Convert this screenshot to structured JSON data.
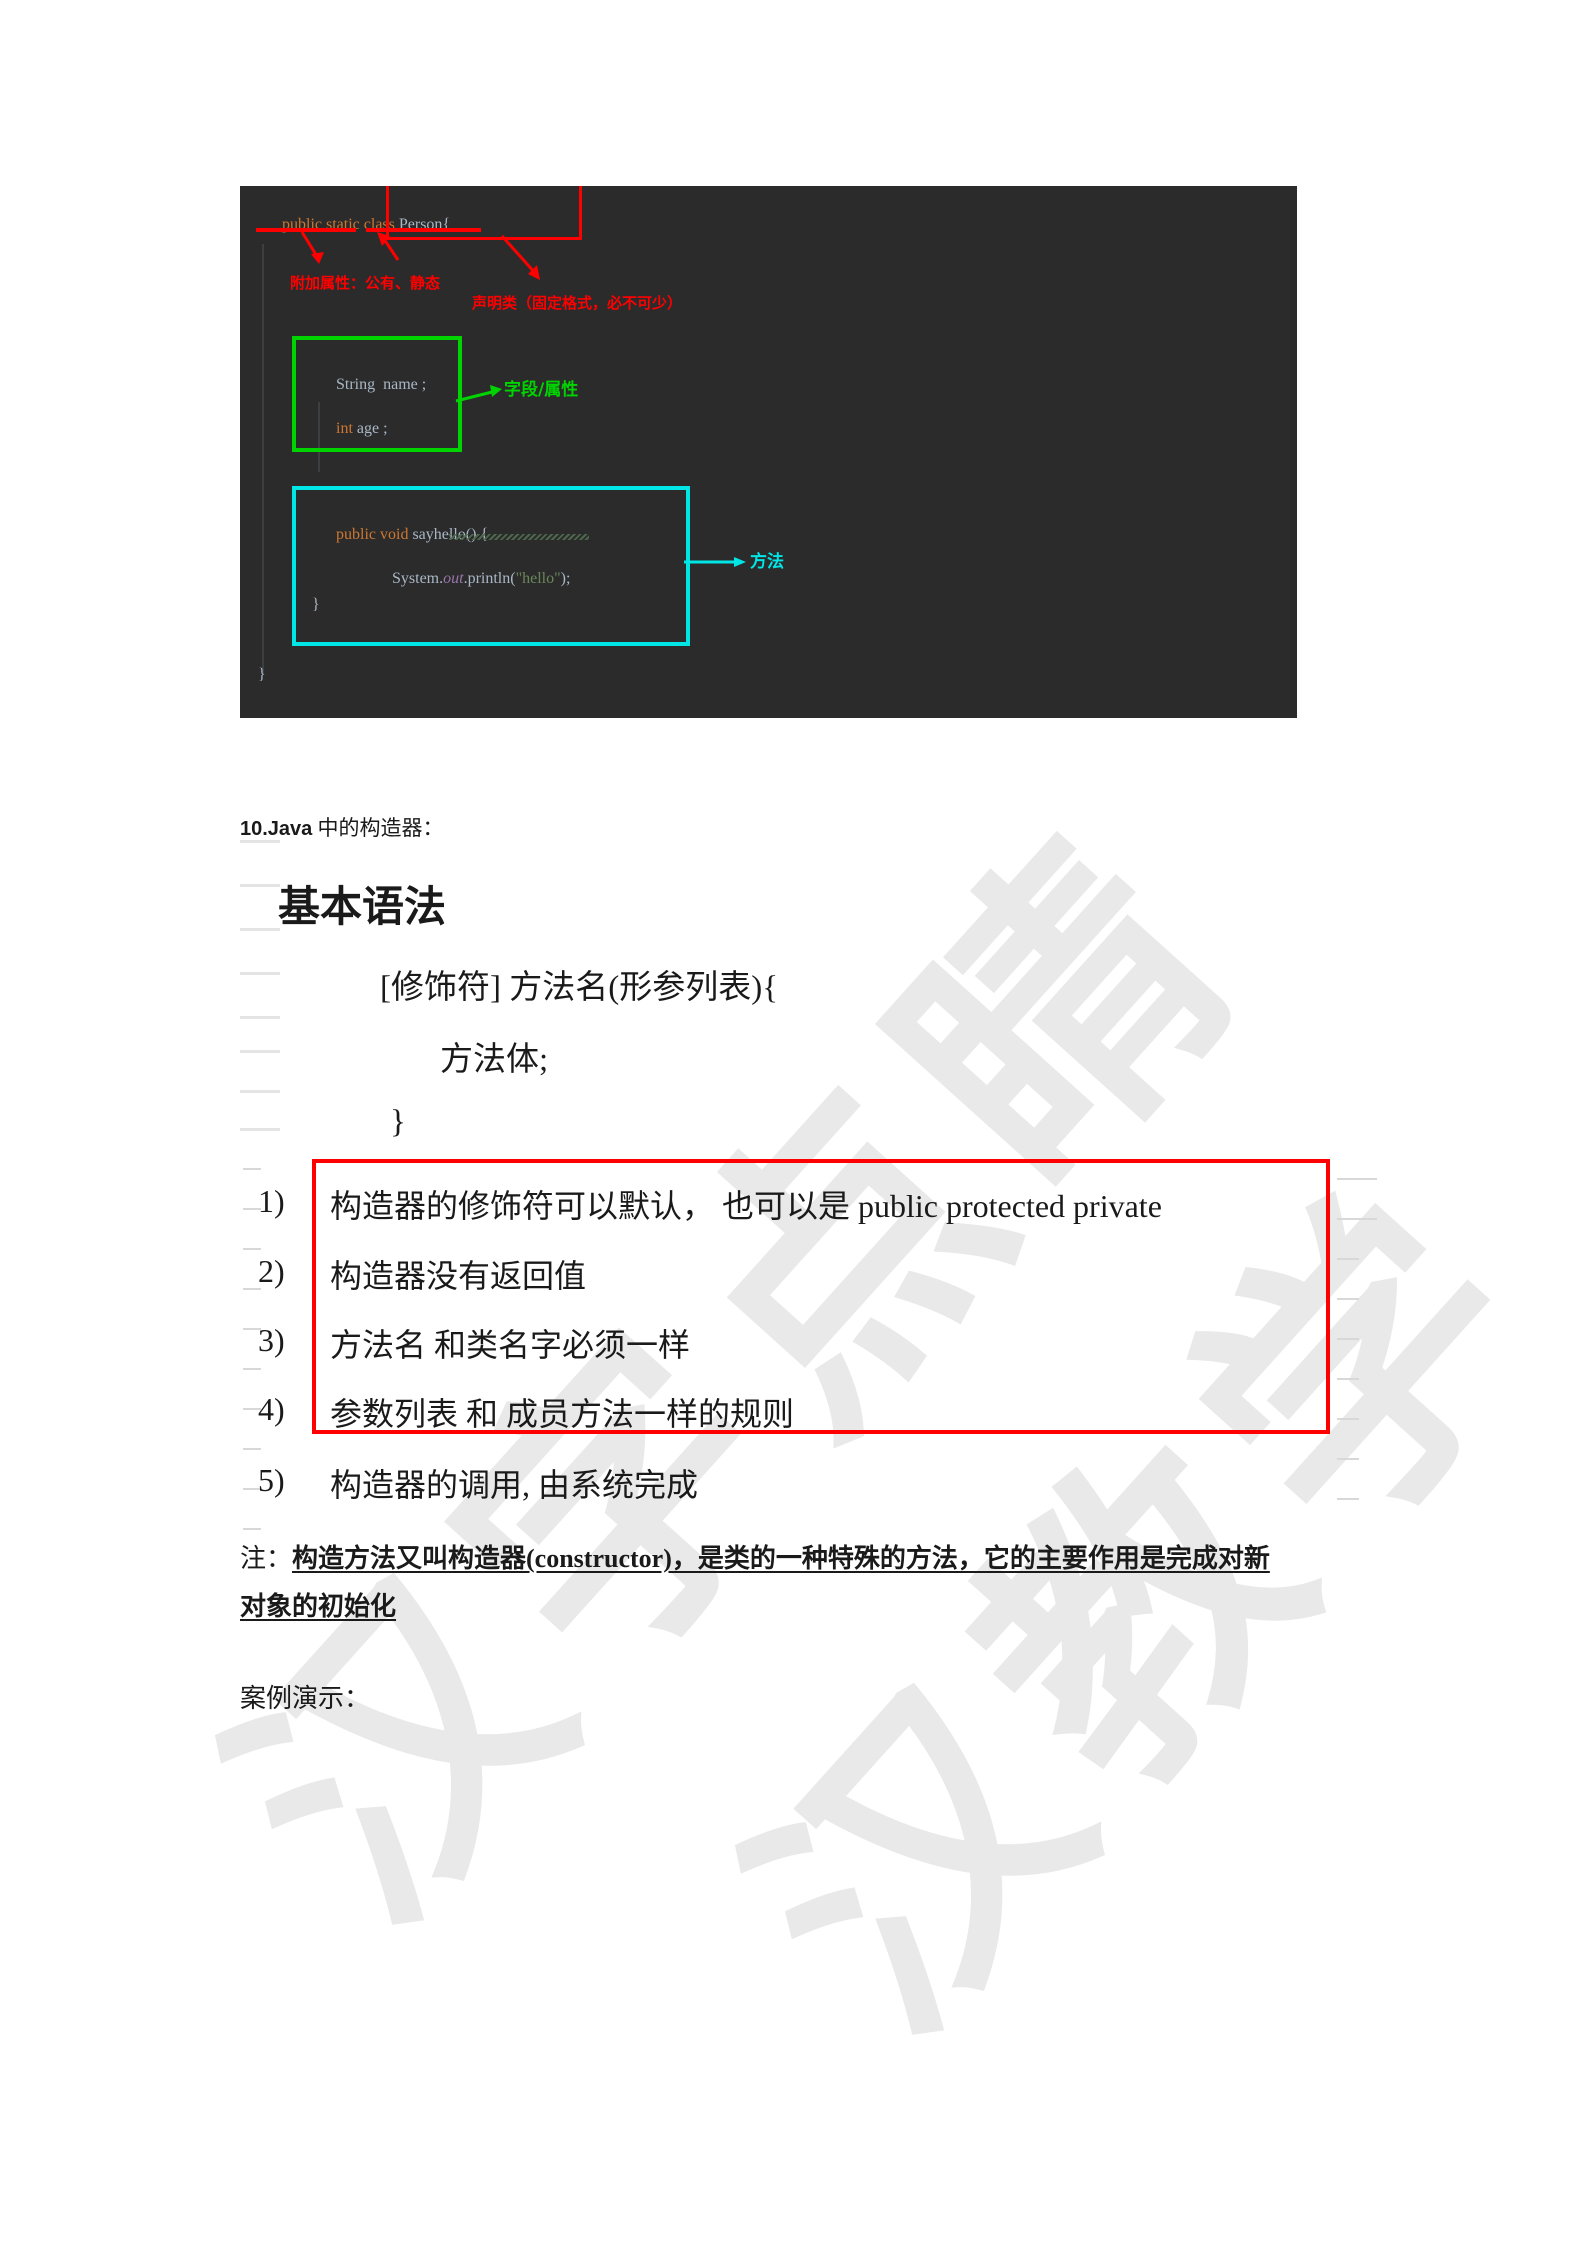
{
  "document": {
    "page_background": "#ffffff",
    "watermark": {
      "text_line1": "汉字点睛",
      "text_line2": "汉教学",
      "color": "#e9e9e9"
    }
  },
  "code_screenshot": {
    "background": "#2b2b2b",
    "colors": {
      "keyword": "#cc7832",
      "identifier": "#a9b7c6",
      "string": "#6a8759",
      "field": "#9876aa",
      "annotation_red": "#ff0000",
      "annotation_green": "#00d400",
      "annotation_cyan": "#00e5e5"
    },
    "lines": [
      {
        "id": "class-decl",
        "tokens": [
          {
            "text": "public",
            "kind": "keyword"
          },
          {
            "text": " ",
            "kind": "plain"
          },
          {
            "text": "static",
            "kind": "keyword"
          },
          {
            "text": " ",
            "kind": "plain"
          },
          {
            "text": "class",
            "kind": "keyword"
          },
          {
            "text": " ",
            "kind": "plain"
          },
          {
            "text": "Person",
            "kind": "identifier"
          },
          {
            "text": "{",
            "kind": "identifier"
          }
        ]
      },
      {
        "id": "field-name",
        "tokens": [
          {
            "text": "String",
            "kind": "identifier"
          },
          {
            "text": "  name ;",
            "kind": "identifier"
          }
        ]
      },
      {
        "id": "field-age",
        "tokens": [
          {
            "text": "int",
            "kind": "keyword"
          },
          {
            "text": " age ;",
            "kind": "identifier"
          }
        ]
      },
      {
        "id": "method-sig",
        "tokens": [
          {
            "text": "public",
            "kind": "keyword"
          },
          {
            "text": " ",
            "kind": "plain"
          },
          {
            "text": "void",
            "kind": "keyword"
          },
          {
            "text": " ",
            "kind": "plain"
          },
          {
            "text": "sayhello",
            "kind": "identifier"
          },
          {
            "text": "() {",
            "kind": "identifier"
          }
        ]
      },
      {
        "id": "method-body",
        "tokens": [
          {
            "text": "System.",
            "kind": "identifier"
          },
          {
            "text": "out",
            "kind": "field"
          },
          {
            "text": ".println(",
            "kind": "identifier"
          },
          {
            "text": "\"hello\"",
            "kind": "string"
          },
          {
            "text": ");",
            "kind": "identifier"
          }
        ]
      },
      {
        "id": "method-close",
        "tokens": [
          {
            "text": "}",
            "kind": "identifier"
          }
        ]
      },
      {
        "id": "class-close",
        "tokens": [
          {
            "text": "}",
            "kind": "identifier"
          }
        ]
      }
    ],
    "code_text": {
      "class_decl": "public static class Person{",
      "field_name": "String  name ;",
      "field_age": "int age ;",
      "method_sig": "public void sayhello() {",
      "method_body": "System.out.println(\"hello\");",
      "method_close": "}",
      "class_close": "}"
    },
    "annotations": [
      {
        "id": "modifiers",
        "label": "附加属性：公有、静态",
        "color": "#ff0000"
      },
      {
        "id": "class-keyword",
        "label": "声明类（固定格式，必不可少）",
        "color": "#ff0000"
      },
      {
        "id": "fields",
        "label": "字段/属性",
        "color": "#00d400"
      },
      {
        "id": "methods",
        "label": "方法",
        "color": "#00e5e5"
      }
    ],
    "annotation_labels": {
      "modifiers": "附加属性：公有、静态",
      "declare_class": "声明类（固定格式，必不可少）",
      "fields": "字段/属性",
      "methods": "方法"
    }
  },
  "body": {
    "section_number_prefix": "10.Java",
    "section_title_rest": " 中的构造器：",
    "heading": "基本语法",
    "syntax_template": {
      "line1": "[修饰符] 方法名(形参列表){",
      "line2": "方法体;",
      "line3": "}"
    },
    "rules": [
      {
        "num": "1)",
        "text_cn": "构造器的修饰符可以默认，  也可以是 ",
        "text_latin": "public protected private",
        "boxed": true
      },
      {
        "num": "2)",
        "text_cn": "构造器没有返回值",
        "text_latin": "",
        "boxed": true
      },
      {
        "num": "3)",
        "text_cn": "方法名  和类名字必须一样",
        "text_latin": "",
        "boxed": true
      },
      {
        "num": "4)",
        "text_cn": "参数列表  和  成员方法一样的规则",
        "text_latin": "",
        "boxed": true
      },
      {
        "num": "5)",
        "text_cn": "构造器的调用, 由系统完成",
        "text_latin": "",
        "boxed": false
      }
    ],
    "note": {
      "label": "注：",
      "line1": "构造方法又叫构造器(constructor)，是类的一种特殊的方法，它的主要作用是完成对新",
      "line2": "对象的初始化"
    },
    "demo_label": "案例演示："
  }
}
